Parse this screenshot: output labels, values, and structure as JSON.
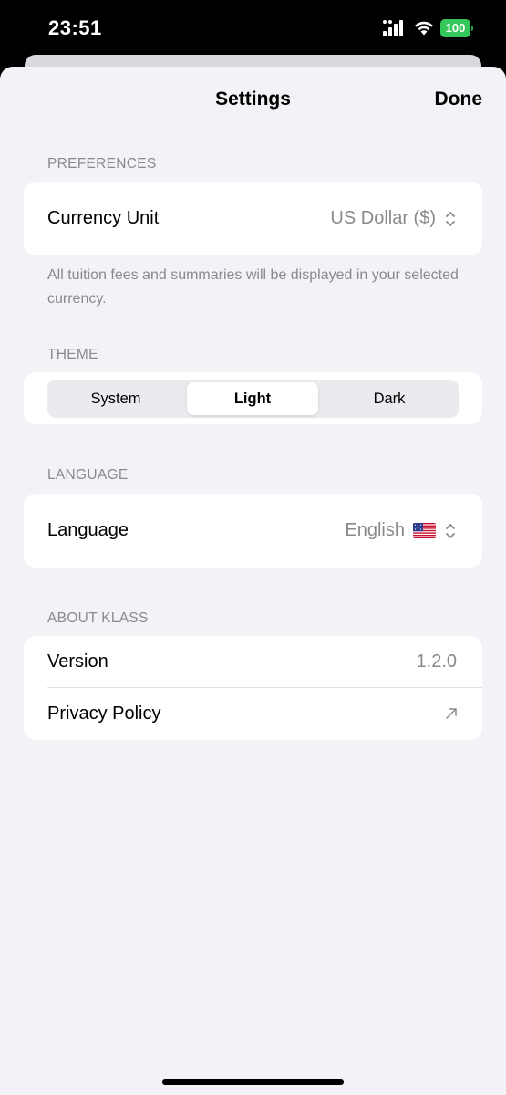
{
  "status_bar": {
    "time": "23:51",
    "battery_level": "100",
    "battery_color": "#34c759"
  },
  "nav": {
    "title": "Settings",
    "done_label": "Done"
  },
  "preferences": {
    "header": "PREFERENCES",
    "currency_label": "Currency Unit",
    "currency_value": "US Dollar ($)",
    "footer": "All tuition fees and summaries will be displayed in your selected currency."
  },
  "theme": {
    "header": "THEME",
    "options": [
      "System",
      "Light",
      "Dark"
    ],
    "selected": "Light"
  },
  "language": {
    "header": "LANGUAGE",
    "label": "Language",
    "value": "English"
  },
  "about": {
    "header": "ABOUT KLASS",
    "version_label": "Version",
    "version_value": "1.2.0",
    "privacy_label": "Privacy Policy"
  },
  "icons": {
    "chevron": "chevron-up-down-icon",
    "external_link": "arrow-up-right-icon",
    "flag": "us-flag-icon"
  }
}
